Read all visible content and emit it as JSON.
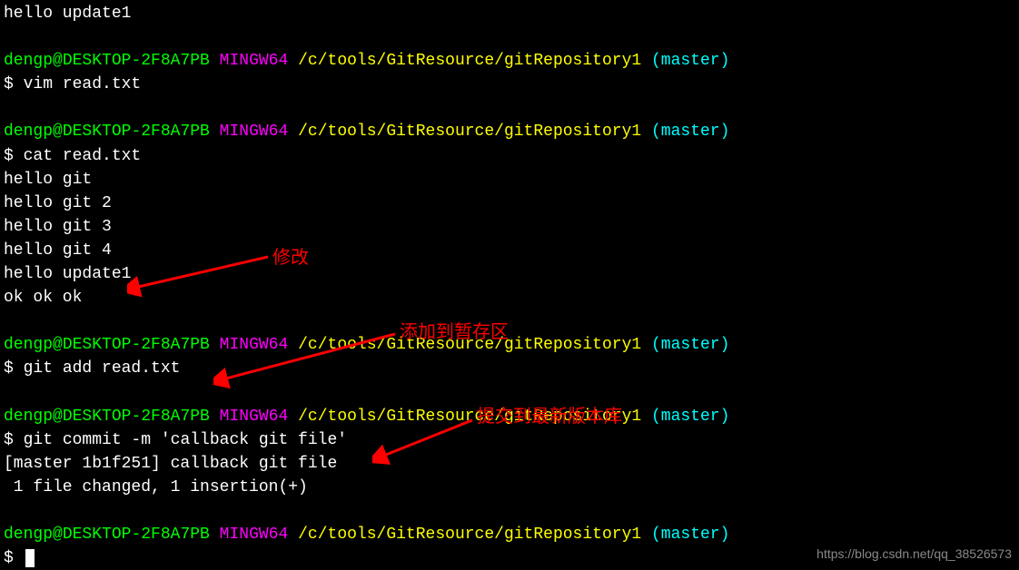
{
  "prompt": {
    "user": "dengp",
    "at": "@",
    "host": "DESKTOP-2F8A7PB",
    "env": "MINGW64",
    "path": "/c/tools/GitResource/gitRepository1",
    "branch": "(master)",
    "dollar": "$ "
  },
  "lines": {
    "l0": "hello update1",
    "cmd1": "vim read.txt",
    "cmd2": "cat read.txt",
    "out1": "hello git",
    "out2": "hello git 2",
    "out3": "hello git 3",
    "out4": "hello git 4",
    "out5": "hello update1",
    "out6": "ok ok ok",
    "cmd3": "git add read.txt",
    "cmd4": "git commit -m 'callback git file'",
    "commit1": "[master 1b1f251] callback git file",
    "commit2": " 1 file changed, 1 insertion(+)"
  },
  "annotations": {
    "a1": "修改",
    "a2": "添加到暂存区",
    "a3": "提交到最新版本库"
  },
  "watermark": "https://blog.csdn.net/qq_38526573"
}
